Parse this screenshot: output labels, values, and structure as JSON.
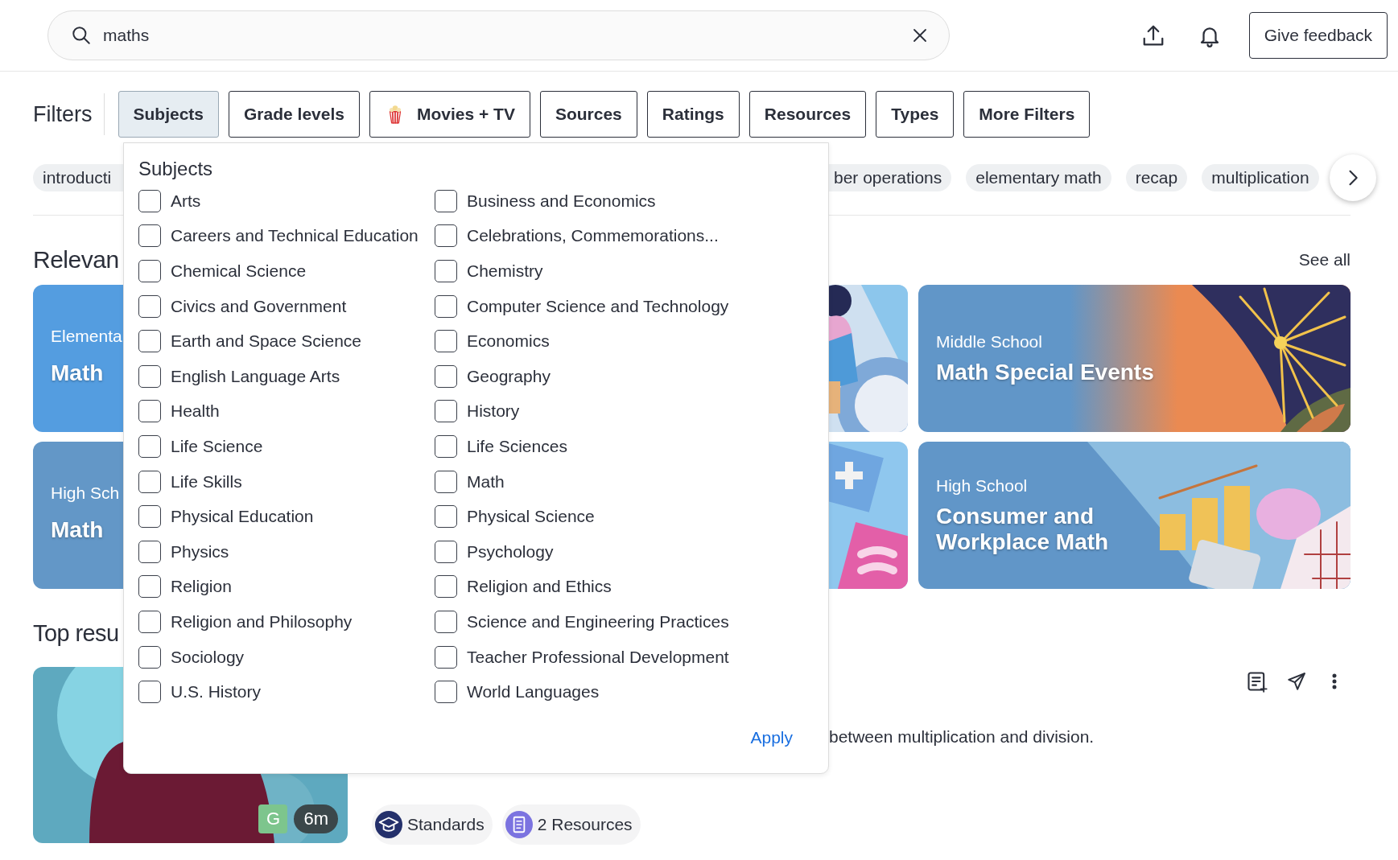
{
  "search": {
    "value": "maths"
  },
  "header": {
    "feedback": "Give feedback"
  },
  "filters": {
    "label": "Filters",
    "buttons": [
      {
        "label": "Subjects",
        "selected": true,
        "kind": "plain"
      },
      {
        "label": "Grade levels",
        "selected": false,
        "kind": "plain"
      },
      {
        "label": "Movies + TV",
        "selected": false,
        "kind": "popcorn"
      },
      {
        "label": "Sources",
        "selected": false,
        "kind": "plain"
      },
      {
        "label": "Ratings",
        "selected": false,
        "kind": "plain"
      },
      {
        "label": "Resources",
        "selected": false,
        "kind": "plain"
      },
      {
        "label": "Types",
        "selected": false,
        "kind": "plain"
      },
      {
        "label": "More Filters",
        "selected": false,
        "kind": "plain"
      }
    ]
  },
  "tags": [
    "introducti",
    "ber operations",
    "elementary math",
    "recap",
    "multiplication"
  ],
  "relevant": {
    "heading": "Relevan",
    "see_all": "See all",
    "cards": [
      {
        "kind": "cut",
        "eyebrow": "Elementa",
        "title": "Math"
      },
      {
        "kind": "picture"
      },
      {
        "kind": "full",
        "eyebrow": "Middle School",
        "title": "Math Special Events"
      },
      {
        "kind": "cut",
        "eyebrow": "High Sch",
        "title": "Math"
      },
      {
        "kind": "picture"
      },
      {
        "kind": "full",
        "eyebrow": "High School",
        "title": "Consumer and Workplace Math"
      }
    ]
  },
  "top_results": {
    "heading": "Top resu",
    "results": [
      {
        "description": "between multiplication and division.",
        "grade": "G",
        "duration": "6m",
        "chips": [
          {
            "kind": "standards",
            "label": "Standards"
          },
          {
            "kind": "resources",
            "label": "2 Resources"
          }
        ]
      }
    ]
  },
  "subjects": {
    "title": "Subjects",
    "apply": "Apply",
    "options": [
      {
        "label": "Arts",
        "checked": false
      },
      {
        "label": "Business and Economics",
        "checked": false
      },
      {
        "label": "Careers and Technical Education",
        "checked": false
      },
      {
        "label": "Celebrations, Commemorations...",
        "checked": false
      },
      {
        "label": "Chemical Science",
        "checked": false
      },
      {
        "label": "Chemistry",
        "checked": false
      },
      {
        "label": "Civics and Government",
        "checked": false
      },
      {
        "label": "Computer Science and Technology",
        "checked": false
      },
      {
        "label": "Earth and Space Science",
        "checked": false
      },
      {
        "label": "Economics",
        "checked": false
      },
      {
        "label": "English Language Arts",
        "checked": false
      },
      {
        "label": "Geography",
        "checked": false
      },
      {
        "label": "Health",
        "checked": false
      },
      {
        "label": "History",
        "checked": false
      },
      {
        "label": "Life Science",
        "checked": false
      },
      {
        "label": "Life Sciences",
        "checked": false
      },
      {
        "label": "Life Skills",
        "checked": false
      },
      {
        "label": "Math",
        "checked": false
      },
      {
        "label": "Physical Education",
        "checked": false
      },
      {
        "label": "Physical Science",
        "checked": false
      },
      {
        "label": "Physics",
        "checked": false
      },
      {
        "label": "Psychology",
        "checked": false
      },
      {
        "label": "Religion",
        "checked": false
      },
      {
        "label": "Religion and Ethics",
        "checked": false
      },
      {
        "label": "Religion and Philosophy",
        "checked": false
      },
      {
        "label": "Science and Engineering Practices",
        "checked": false
      },
      {
        "label": "Sociology",
        "checked": false
      },
      {
        "label": "Teacher Professional Development",
        "checked": false
      },
      {
        "label": "U.S. History",
        "checked": false
      },
      {
        "label": "World Languages",
        "checked": false
      }
    ]
  }
}
